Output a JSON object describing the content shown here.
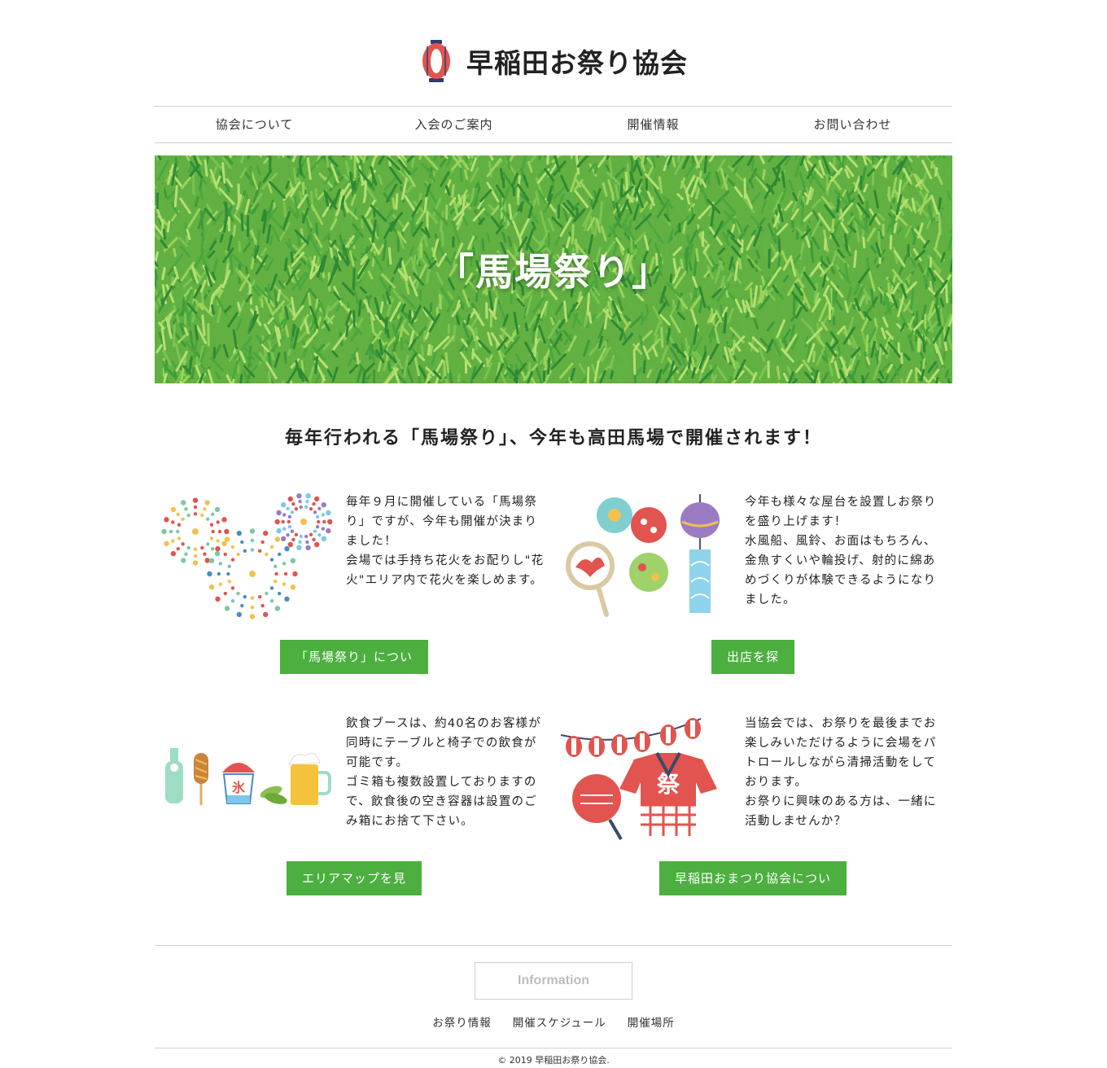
{
  "header": {
    "title": "早稲田お祭り協会"
  },
  "nav": {
    "items": [
      {
        "label": "協会について"
      },
      {
        "label": "入会のご案内"
      },
      {
        "label": "開催情報"
      },
      {
        "label": "お問い合わせ"
      }
    ]
  },
  "hero": {
    "title": "「馬場祭り」"
  },
  "lead": {
    "text": "毎年行われる「馬場祭り」、今年も高田馬場で開催されます！"
  },
  "cards": [
    {
      "illustration": "fireworks-icon",
      "lines": [
        "毎年９月に開催している「馬場祭り」ですが、今年も開催が決まりました！",
        "会場では手持ち花火をお配りし\"花火\"エリア内で花火を楽しめます。"
      ],
      "button": "「馬場祭り」について"
    },
    {
      "illustration": "yoyo-balloons-icon",
      "lines": [
        "今年も様々な屋台を設置しお祭りを盛り上げます！",
        "水風船、風鈴、お面はもちろん、金魚すくいや輪投げ、射的に綿あめづくりが体験できるようになりました。"
      ],
      "button": "出店を探す"
    },
    {
      "illustration": "festival-food-icon",
      "lines": [
        "飲食ブースは、約40名のお客様が同時にテーブルと椅子での飲食が可能です。",
        "ゴミ箱も複数設置しておりますので、飲食後の空き容器は設置のごみ箱にお捨て下さい。"
      ],
      "button": "エリアマップを見る"
    },
    {
      "illustration": "happi-lantern-icon",
      "lines": [
        "当協会では、お祭りを最後までお楽しみいただけるように会場をパトロールしながら清掃活動をしております。",
        "お祭りに興味のある方は、一緒に活動しませんか？"
      ],
      "button": "早稲田おまつり協会について"
    }
  ],
  "footer": {
    "info_label": "Information",
    "links": [
      "お祭り情報",
      "開催スケジュール",
      "開催場所"
    ],
    "copyright": "© 2019 早稲田お祭り協会."
  },
  "colors": {
    "accent": "#4caf3f",
    "lantern": "#e2544f"
  }
}
